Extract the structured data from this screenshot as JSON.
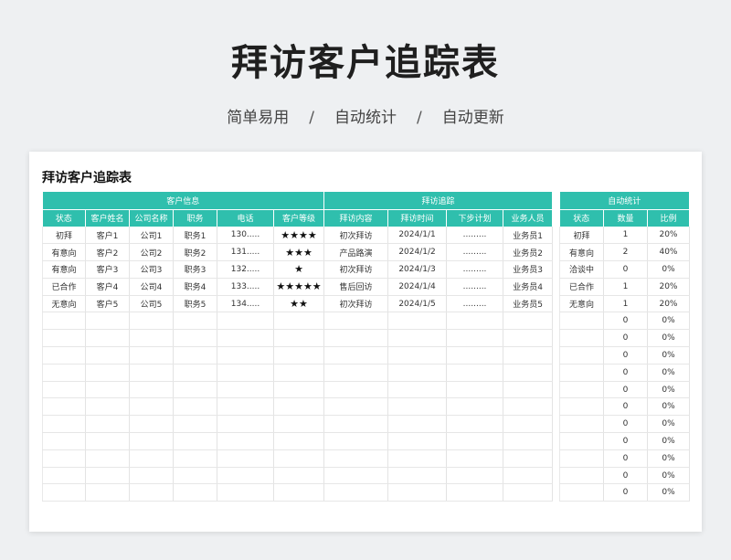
{
  "hero": {
    "title": "拜访客户追踪表",
    "tags": [
      "简单易用",
      "自动统计",
      "自动更新"
    ],
    "separator": "/"
  },
  "sheet": {
    "title": "拜访客户追踪表",
    "groups": {
      "customer_info": "客户信息",
      "visit_tracking": "拜访追踪",
      "auto_stats": "自动统计"
    },
    "columns": [
      "状态",
      "客户姓名",
      "公司名称",
      "职务",
      "电话",
      "客户等级",
      "拜访内容",
      "拜访时间",
      "下步计划",
      "业务人员"
    ],
    "rows": [
      [
        "初拜",
        "客户1",
        "公司1",
        "职务1",
        "130.....",
        "★★★★",
        "初次拜访",
        "2024/1/1",
        ".........",
        "业务员1"
      ],
      [
        "有意向",
        "客户2",
        "公司2",
        "职务2",
        "131.....",
        "★★★",
        "产品路演",
        "2024/1/2",
        ".........",
        "业务员2"
      ],
      [
        "有意向",
        "客户3",
        "公司3",
        "职务3",
        "132.....",
        "★",
        "初次拜访",
        "2024/1/3",
        ".........",
        "业务员3"
      ],
      [
        "已合作",
        "客户4",
        "公司4",
        "职务4",
        "133.....",
        "★★★★★",
        "售后回访",
        "2024/1/4",
        ".........",
        "业务员4"
      ],
      [
        "无意向",
        "客户5",
        "公司5",
        "职务5",
        "134.....",
        "★★",
        "初次拜访",
        "2024/1/5",
        ".........",
        "业务员5"
      ]
    ],
    "empty_rows": 11,
    "stats": {
      "columns": [
        "状态",
        "数量",
        "比例"
      ],
      "rows": [
        [
          "初拜",
          "1",
          "20%"
        ],
        [
          "有意向",
          "2",
          "40%"
        ],
        [
          "洽谈中",
          "0",
          "0%"
        ],
        [
          "已合作",
          "1",
          "20%"
        ],
        [
          "无意向",
          "1",
          "20%"
        ],
        [
          "",
          "0",
          "0%"
        ],
        [
          "",
          "0",
          "0%"
        ],
        [
          "",
          "0",
          "0%"
        ],
        [
          "",
          "0",
          "0%"
        ],
        [
          "",
          "0",
          "0%"
        ],
        [
          "",
          "0",
          "0%"
        ],
        [
          "",
          "0",
          "0%"
        ],
        [
          "",
          "0",
          "0%"
        ],
        [
          "",
          "0",
          "0%"
        ],
        [
          "",
          "0",
          "0%"
        ],
        [
          "",
          "0",
          "0%"
        ]
      ]
    },
    "accent_color": "#2fbfad"
  }
}
